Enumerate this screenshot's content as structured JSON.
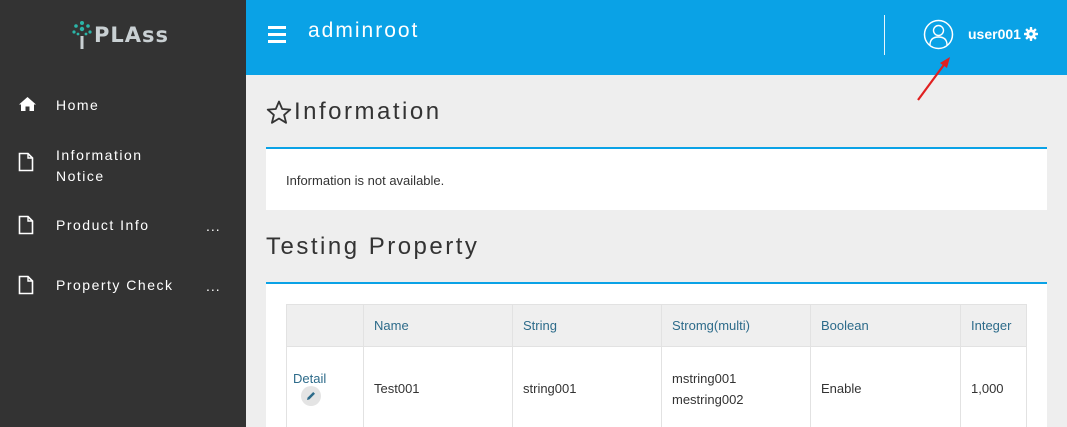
{
  "sidebar": {
    "logo_text": "PLAss",
    "items": [
      {
        "label": "Home",
        "icon": "home-icon"
      },
      {
        "label": "Information Notice",
        "icon": "document-icon"
      },
      {
        "label": "Product Info",
        "icon": "document-icon",
        "more": "..."
      },
      {
        "label": "Property Check",
        "icon": "document-icon",
        "more": "..."
      }
    ]
  },
  "header": {
    "title": "adminroot",
    "username": "user001",
    "menu_icon": "hamburger-icon",
    "avatar_icon": "user-avatar-icon",
    "settings_icon": "gear-icon"
  },
  "information": {
    "title": "Information",
    "message": "Information is not available."
  },
  "testing": {
    "title": "Testing Property",
    "columns": [
      "Name",
      "String",
      "Stromg(multi)",
      "Boolean",
      "Integer"
    ],
    "rows": [
      {
        "detail_label": "Detail",
        "name": "Test001",
        "string": "string001",
        "string_multi": [
          "mstring001",
          "mestring002"
        ],
        "boolean": "Enable",
        "integer": "1,000"
      }
    ]
  },
  "colors": {
    "accent": "#0aa2e6",
    "sidebar_bg": "#333333",
    "annotation": "#e02020"
  }
}
